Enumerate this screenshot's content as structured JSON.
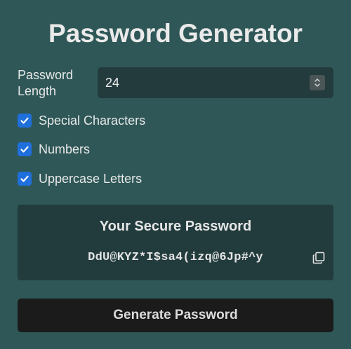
{
  "app": {
    "title": "Password Generator",
    "colors": {
      "background": "#2f5757",
      "panel": "#223b3d",
      "checkbox": "#1f6fdc",
      "button": "#1b1b1b"
    }
  },
  "length": {
    "label": "Password Length",
    "value": "24"
  },
  "options": [
    {
      "label": "Special Characters",
      "checked": true
    },
    {
      "label": "Numbers",
      "checked": true
    },
    {
      "label": "Uppercase Letters",
      "checked": true
    }
  ],
  "result": {
    "title": "Your Secure Password",
    "password": "DdU@KYZ*I$sa4(izq@6Jp#^y",
    "copy_icon": "copy-icon"
  },
  "actions": {
    "generate_label": "Generate Password"
  }
}
